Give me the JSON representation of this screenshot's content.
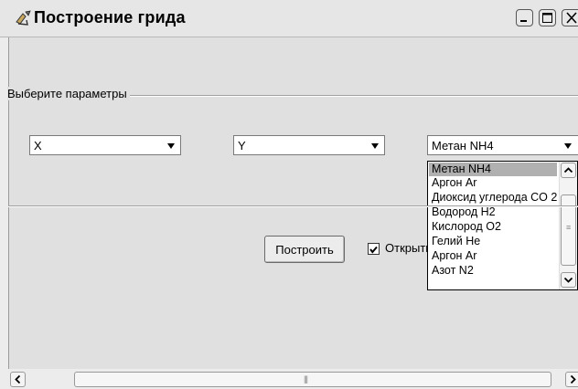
{
  "window": {
    "title": "Построение грида",
    "icon": "app-pen-icon"
  },
  "group": {
    "label": "Выберите параметры"
  },
  "combos": [
    {
      "value": "X"
    },
    {
      "value": "Y"
    },
    {
      "value": "Метан  NH4"
    }
  ],
  "dropdown": {
    "items": [
      "Метан  NH4",
      "Аргон Ar",
      "Диоксид углерода  CO 2",
      "Водород H2",
      "Кислород O2",
      "Гелий He",
      "Аргон Ar",
      "Азот N2"
    ],
    "selected_index": 0
  },
  "build_button": {
    "label": "Построить"
  },
  "checkbox": {
    "label": "Открыть",
    "checked": true
  },
  "colors": {
    "window_bg": "#e0e0e0",
    "selected_item_bg": "#b0b0b0"
  }
}
